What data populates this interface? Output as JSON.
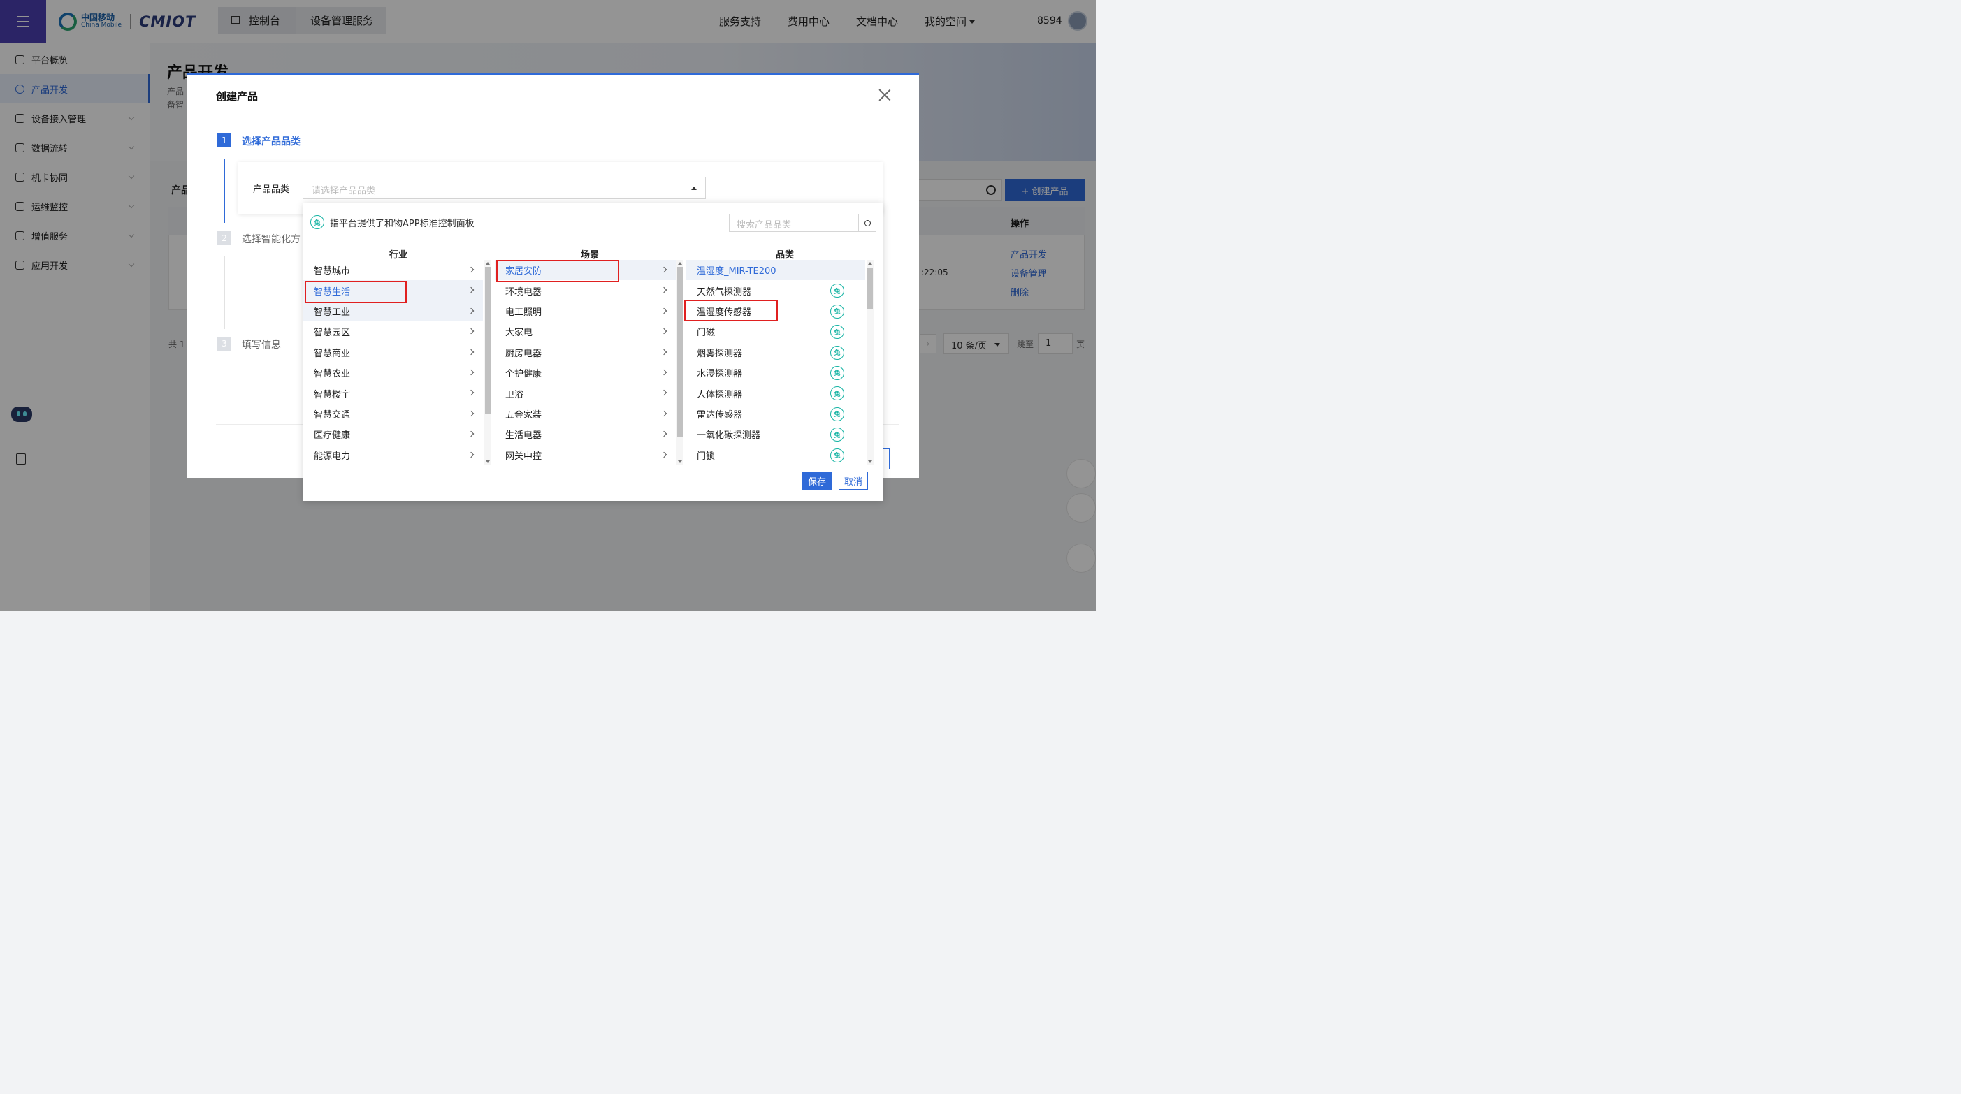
{
  "header": {
    "logo_cn": "中国移动",
    "logo_en": "China Mobile",
    "logo_brand": "CMIOT",
    "crumbs": [
      "控制台",
      "设备管理服务"
    ],
    "nav": [
      "服务支持",
      "费用中心",
      "文档中心",
      "我的空间"
    ],
    "user_id": "8594"
  },
  "sidebar": {
    "items": [
      {
        "label": "平台概览"
      },
      {
        "label": "产品开发"
      },
      {
        "label": "设备接入管理"
      },
      {
        "label": "数据流转"
      },
      {
        "label": "机卡协同"
      },
      {
        "label": "运维监控"
      },
      {
        "label": "增值服务"
      },
      {
        "label": "应用开发"
      }
    ]
  },
  "background": {
    "page_title": "产品开发",
    "desc_line1": "产品",
    "desc_line2": "备智",
    "section_title": "产品",
    "create_button": "+ 创建产品",
    "table_op_header": "操作",
    "row_time": ":22:05",
    "row_links": [
      "产品开发",
      "设备管理",
      "删除"
    ],
    "total_prefix": "共 1",
    "page_size": "10 条/页",
    "jump_label": "跳至",
    "jump_value": "1",
    "page_suffix": "页"
  },
  "modal": {
    "title": "创建产品",
    "steps": [
      {
        "num": "1",
        "label": "选择产品品类"
      },
      {
        "num": "2",
        "label": "选择智能化方"
      },
      {
        "num": "3",
        "label": "填写信息"
      }
    ],
    "field_label": "产品品类",
    "field_placeholder": "请选择产品品类"
  },
  "dropdown": {
    "badge": "免",
    "hint": "指平台提供了和物APP标准控制面板",
    "search_placeholder": "搜索产品品类",
    "col_industry": "行业",
    "col_scene": "场景",
    "col_category": "品类",
    "industries": [
      "智慧城市",
      "智慧生活",
      "智慧工业",
      "智慧园区",
      "智慧商业",
      "智慧农业",
      "智慧楼宇",
      "智慧交通",
      "医疗健康",
      "能源电力"
    ],
    "scenes": [
      "家居安防",
      "环境电器",
      "电工照明",
      "大家电",
      "厨房电器",
      "个护健康",
      "卫浴",
      "五金家装",
      "生活电器",
      "网关中控"
    ],
    "categories": [
      "温湿度_MIR-TE200",
      "天然气探测器",
      "温湿度传感器",
      "门磁",
      "烟雾探测器",
      "水浸探测器",
      "人体探测器",
      "雷达传感器",
      "一氧化碳探测器",
      "门锁"
    ],
    "save": "保存",
    "cancel": "取消"
  },
  "colors": {
    "primary": "#2f6ad8",
    "menu_purple": "#4a3fb0",
    "highlight_red": "#e02020",
    "badge_teal": "#16b4a4"
  }
}
